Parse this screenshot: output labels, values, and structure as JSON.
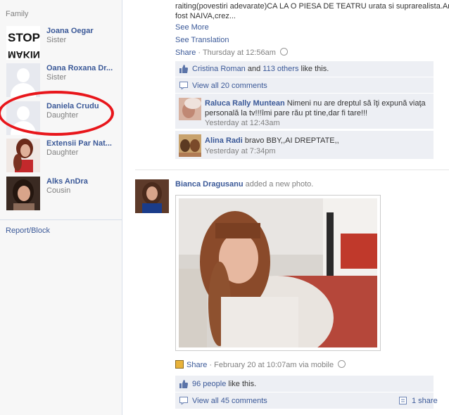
{
  "family": {
    "title": "Family",
    "members": [
      {
        "name": "Joana Oegar",
        "relation": "Sister",
        "thumb_text": "STOP MAKING"
      },
      {
        "name": "Oana Roxana Dr...",
        "relation": "Sister"
      },
      {
        "name": "Daniela Crudu",
        "relation": "Daughter"
      },
      {
        "name": "Extensii Par Nat...",
        "relation": "Daughter"
      },
      {
        "name": "Alks AnDra",
        "relation": "Cousin"
      }
    ],
    "report_label": "Report/Block"
  },
  "post1": {
    "text_line1": "raiting(povestiri adevarate)CA LA O PIESA DE TEATRU urata si suprarealista.Am",
    "text_line2": "fost NAIVA,crez...",
    "see_more": "See More",
    "see_translation": "See Translation",
    "share": "Share",
    "time": "Thursday at 12:56am",
    "likes_prefix": "Cristina Roman",
    "likes_and": " and ",
    "likes_others": "113 others",
    "likes_suffix": " like this.",
    "view_comments": "View all 20 comments",
    "comments": [
      {
        "author": "Raluca Rally Muntean",
        "text1": "Nimeni nu are dreptul să îţi expună viaţa",
        "text2": "personală la tv!!!îmi pare rău pt tine,dar fi tare!!!",
        "time": "Yesterday at 12:43am"
      },
      {
        "author": "Alina Radi",
        "text1": "bravo BBY,,AI DREPTATE,,",
        "time": "Yesterday at 7:34pm"
      }
    ]
  },
  "post2": {
    "author": "Bianca Dragusanu",
    "action": "added a new photo.",
    "share": "Share",
    "time": "February 20 at 10:07am via mobile",
    "likes_count": "96 people",
    "likes_suffix": " like this.",
    "view_comments": "View all 45 comments",
    "shares": "1 share"
  },
  "colors": {
    "link": "#3b5998",
    "highlight_ring": "#e8161b",
    "bar_bg": "#edeff4"
  }
}
